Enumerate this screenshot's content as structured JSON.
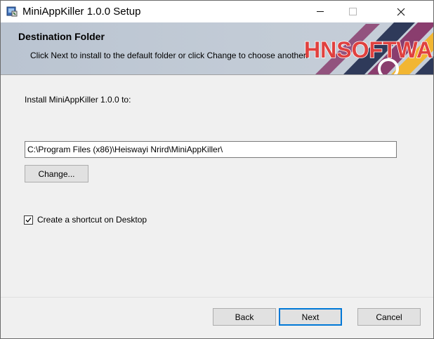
{
  "window": {
    "title": "MiniAppKiller 1.0.0 Setup",
    "controls": {
      "minimize": "minimize-icon",
      "maximize": "maximize-icon",
      "close": "close-icon"
    }
  },
  "header": {
    "title": "Destination Folder",
    "description": "Click Next to install to the default folder or click Change to choose another.",
    "logo_text": "HNSOFTWARE"
  },
  "main": {
    "install_label": "Install MiniAppKiller 1.0.0 to:",
    "path_value": "C:\\Program Files (x86)\\Heiswayi Nrird\\MiniAppKiller\\",
    "change_label": "Change...",
    "shortcut": {
      "label": "Create a shortcut on Desktop",
      "checked": true
    }
  },
  "footer": {
    "back_label": "Back",
    "next_label": "Next",
    "cancel_label": "Cancel"
  },
  "colors": {
    "focus": "#0078d7",
    "banner_bg": "#c2cbd6",
    "logo_red": "#e0413f",
    "stripe_navy": "#2f3a5a",
    "stripe_purple": "#8a3d6e",
    "stripe_yellow": "#f2b632"
  }
}
